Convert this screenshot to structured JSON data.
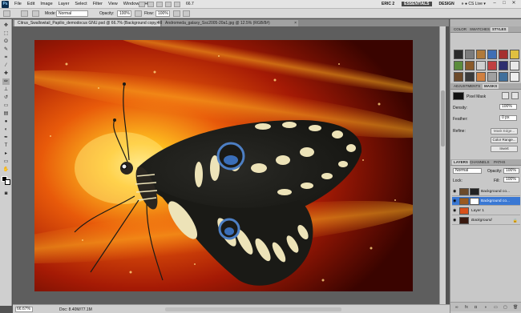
{
  "menubar": {
    "logo": "Ps",
    "items": [
      "File",
      "Edit",
      "Image",
      "Layer",
      "Select",
      "Filter",
      "View",
      "Window",
      "Help"
    ],
    "zoom": "66.7",
    "user": "ERIC 2",
    "workspaces": [
      "ESSENTIALS",
      "DESIGN"
    ],
    "more": "»",
    "cslive": "CS Live",
    "window_controls": [
      "–",
      "□",
      "✕"
    ]
  },
  "options": {
    "mode_label": "Mode:",
    "mode_value": "Normal",
    "opacity_label": "Opacity:",
    "opacity_value": "100%",
    "flow_label": "Flow:",
    "flow_value": "100%"
  },
  "tabs": [
    {
      "label": "Citrus_Swallowtail_Papilio_demodocus GNU.psd @ 66.7% (Background copy, RGB/8)*",
      "close": "×"
    },
    {
      "label": "Andromeda_galaxy_Ssc2005-20a1.jpg @ 12.5% (RGB/8#)",
      "close": "×"
    }
  ],
  "status": {
    "zoom": "66.67%",
    "doc": "Doc: 8.40M/77.1M"
  },
  "styles_panel": {
    "tabs": [
      "COLOR",
      "SWATCHES",
      "STYLES"
    ],
    "swatches": [
      "#2b2b2b",
      "#7c7c7c",
      "#b07a3a",
      "#3e6fb5",
      "#a52f2f",
      "#e0c040",
      "#5c8c3c",
      "#8a5a2a",
      "#cfcfcf",
      "#c04040",
      "#2e2e6e",
      "#e8e8e8",
      "#6c4a2a",
      "#3a3a3a",
      "#d08040",
      "#a0a0a0",
      "#40709c",
      "#efefef"
    ]
  },
  "masks_panel": {
    "tabs": [
      "ADJUSTMENTS",
      "MASKS"
    ],
    "title": "Pixel Mask",
    "density_label": "Density:",
    "density_value": "100%",
    "feather_label": "Feather:",
    "feather_value": "0 px",
    "refine_label": "Refine:",
    "buttons": [
      "Mask Edge...",
      "Color Range...",
      "Invert"
    ]
  },
  "layers_panel": {
    "tabs": [
      "LAYERS",
      "CHANNELS",
      "PATHS"
    ],
    "blend": "Normal",
    "opacity_label": "Opacity:",
    "opacity_value": "100%",
    "lock_label": "Lock:",
    "fill_label": "Fill:",
    "fill_value": "100%",
    "layers": [
      {
        "name": "Background co...",
        "selected": false,
        "masked": true
      },
      {
        "name": "Background co...",
        "selected": true,
        "masked": true
      },
      {
        "name": "Layer 1",
        "selected": false,
        "masked": false
      },
      {
        "name": "Background",
        "selected": false,
        "masked": false
      }
    ],
    "footer_icons": [
      "link-icon",
      "fx-icon",
      "mask-icon",
      "adjustment-icon",
      "folder-icon",
      "new-layer-icon",
      "trash-icon"
    ]
  },
  "colors": {
    "chrome": "#535353",
    "selection": "#3a78d4"
  }
}
